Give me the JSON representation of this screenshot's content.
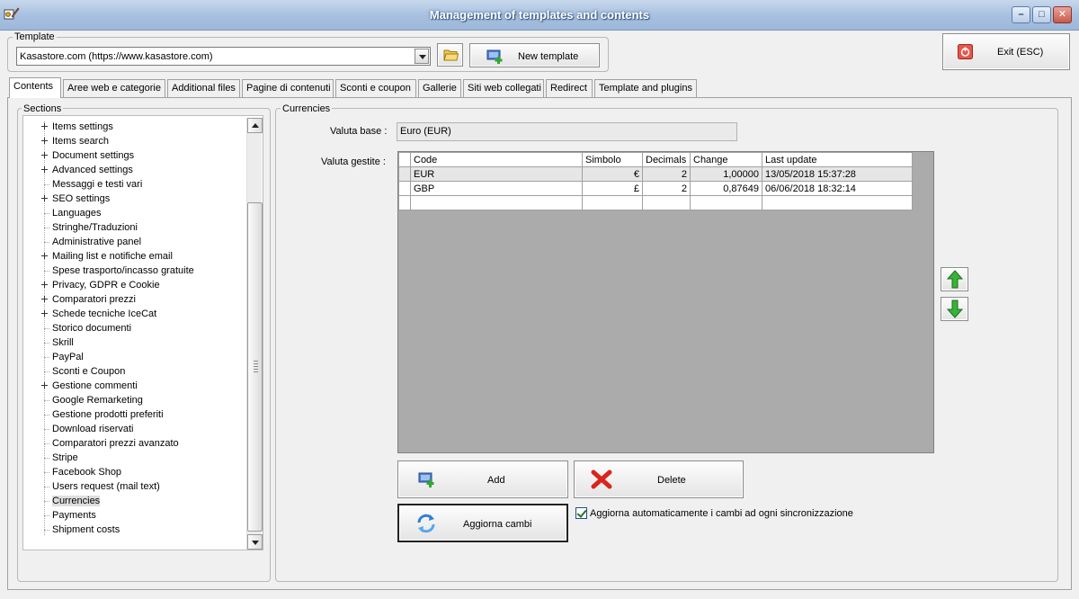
{
  "window": {
    "title": "Management of templates and contents"
  },
  "template": {
    "group_label": "Template",
    "selected": "Kasastore.com (https://www.kasastore.com)",
    "new_button": "New template",
    "exit_button": "Exit (ESC)"
  },
  "tabs": [
    {
      "label": "Contents"
    },
    {
      "label": "Aree web e categorie"
    },
    {
      "label": "Additional files"
    },
    {
      "label": "Pagine di contenuti"
    },
    {
      "label": "Sconti e coupon"
    },
    {
      "label": "Gallerie"
    },
    {
      "label": "Siti web collegati"
    },
    {
      "label": "Redirect"
    },
    {
      "label": "Template and plugins"
    }
  ],
  "sections": {
    "label": "Sections",
    "items": [
      {
        "label": "Items settings",
        "expandable": true
      },
      {
        "label": "Items search",
        "expandable": true
      },
      {
        "label": "Document settings",
        "expandable": true
      },
      {
        "label": "Advanced settings",
        "expandable": true
      },
      {
        "label": "Messaggi e testi vari",
        "expandable": false
      },
      {
        "label": "SEO settings",
        "expandable": true
      },
      {
        "label": "Languages",
        "expandable": false
      },
      {
        "label": "Stringhe/Traduzioni",
        "expandable": false
      },
      {
        "label": "Administrative panel",
        "expandable": false
      },
      {
        "label": "Mailing list e notifiche email",
        "expandable": true
      },
      {
        "label": "Spese trasporto/incasso gratuite",
        "expandable": false
      },
      {
        "label": "Privacy, GDPR e Cookie",
        "expandable": true
      },
      {
        "label": "Comparatori prezzi",
        "expandable": true
      },
      {
        "label": "Schede tecniche IceCat",
        "expandable": true
      },
      {
        "label": "Storico documenti",
        "expandable": false
      },
      {
        "label": "Skrill",
        "expandable": false
      },
      {
        "label": "PayPal",
        "expandable": false
      },
      {
        "label": "Sconti e Coupon",
        "expandable": false
      },
      {
        "label": "Gestione commenti",
        "expandable": true
      },
      {
        "label": "Google Remarketing",
        "expandable": false
      },
      {
        "label": "Gestione prodotti preferiti",
        "expandable": false
      },
      {
        "label": "Download riservati",
        "expandable": false
      },
      {
        "label": "Comparatori prezzi avanzato",
        "expandable": false
      },
      {
        "label": "Stripe",
        "expandable": false
      },
      {
        "label": "Facebook Shop",
        "expandable": false
      },
      {
        "label": "Users request (mail text)",
        "expandable": false
      },
      {
        "label": "Currencies",
        "expandable": false,
        "selected": true
      },
      {
        "label": "Payments",
        "expandable": false
      },
      {
        "label": "Shipment costs",
        "expandable": false
      }
    ]
  },
  "currencies": {
    "group_label": "Currencies",
    "base_label": "Valuta base :",
    "base_value": "Euro (EUR)",
    "managed_label": "Valuta gestite :",
    "columns": [
      "Code",
      "Simbolo",
      "Decimals",
      "Change",
      "Last update"
    ],
    "rows": [
      [
        "EUR",
        "€",
        "2",
        "1,00000",
        "13/05/2018 15:37:28"
      ],
      [
        "GBP",
        "£",
        "2",
        "0,87649",
        "06/06/2018 18:32:14"
      ],
      [
        "",
        "",
        "",
        "",
        ""
      ]
    ],
    "add_button": "Add",
    "delete_button": "Delete",
    "update_button": "Aggiorna cambi",
    "auto_update_label": "Aggiorna automaticamente i cambi ad ogni sincronizzazione",
    "auto_update_checked": true
  },
  "icons": {
    "app": "app-icon",
    "folder": "folder-icon",
    "new_template": "add-icon",
    "exit": "power-icon",
    "add": "add-icon",
    "delete": "delete-icon",
    "refresh": "refresh-icon",
    "up": "arrow-up-icon",
    "down": "arrow-down-icon"
  },
  "colors": {
    "green": "#2fa82f",
    "red": "#d9251d",
    "grid_bg": "#ababab",
    "titlebar": "#a9c1e0"
  }
}
